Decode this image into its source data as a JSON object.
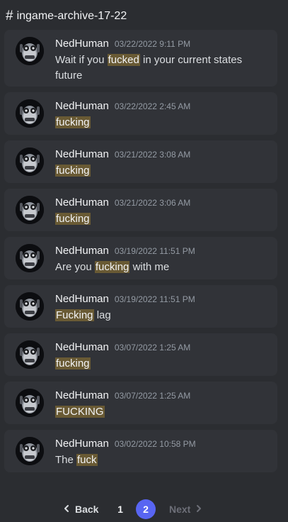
{
  "channel": {
    "hash": "#",
    "name": "ingame-archive-17-22"
  },
  "messages": [
    {
      "author": "NedHuman",
      "timestamp": "03/22/2022 9:11 PM",
      "text_before": "Wait if you ",
      "highlight": "fucked",
      "text_after": " in your current states future"
    },
    {
      "author": "NedHuman",
      "timestamp": "03/22/2022 2:45 AM",
      "text_before": "",
      "highlight": "fucking",
      "text_after": ""
    },
    {
      "author": "NedHuman",
      "timestamp": "03/21/2022 3:08 AM",
      "text_before": "",
      "highlight": "fucking",
      "text_after": ""
    },
    {
      "author": "NedHuman",
      "timestamp": "03/21/2022 3:06 AM",
      "text_before": "",
      "highlight": "fucking",
      "text_after": ""
    },
    {
      "author": "NedHuman",
      "timestamp": "03/19/2022 11:51 PM",
      "text_before": "Are you ",
      "highlight": "fucking",
      "text_after": " with me"
    },
    {
      "author": "NedHuman",
      "timestamp": "03/19/2022 11:51 PM",
      "text_before": "",
      "highlight": "Fucking",
      "text_after": " lag"
    },
    {
      "author": "NedHuman",
      "timestamp": "03/07/2022 1:25 AM",
      "text_before": "",
      "highlight": "fucking",
      "text_after": ""
    },
    {
      "author": "NedHuman",
      "timestamp": "03/07/2022 1:25 AM",
      "text_before": "",
      "highlight": "FUCKING",
      "text_after": ""
    },
    {
      "author": "NedHuman",
      "timestamp": "03/02/2022 10:58 PM",
      "text_before": "The ",
      "highlight": "fuck",
      "text_after": ""
    }
  ],
  "pagination": {
    "back_label": "Back",
    "next_label": "Next",
    "pages": [
      "1",
      "2"
    ],
    "current_page": "2"
  },
  "colors": {
    "background": "#2b2d31",
    "message_background": "#313338",
    "highlight": "#695a34",
    "current_page": "#5865f2"
  },
  "icons": {
    "back": "chevron-left-icon",
    "next": "chevron-right-icon"
  }
}
